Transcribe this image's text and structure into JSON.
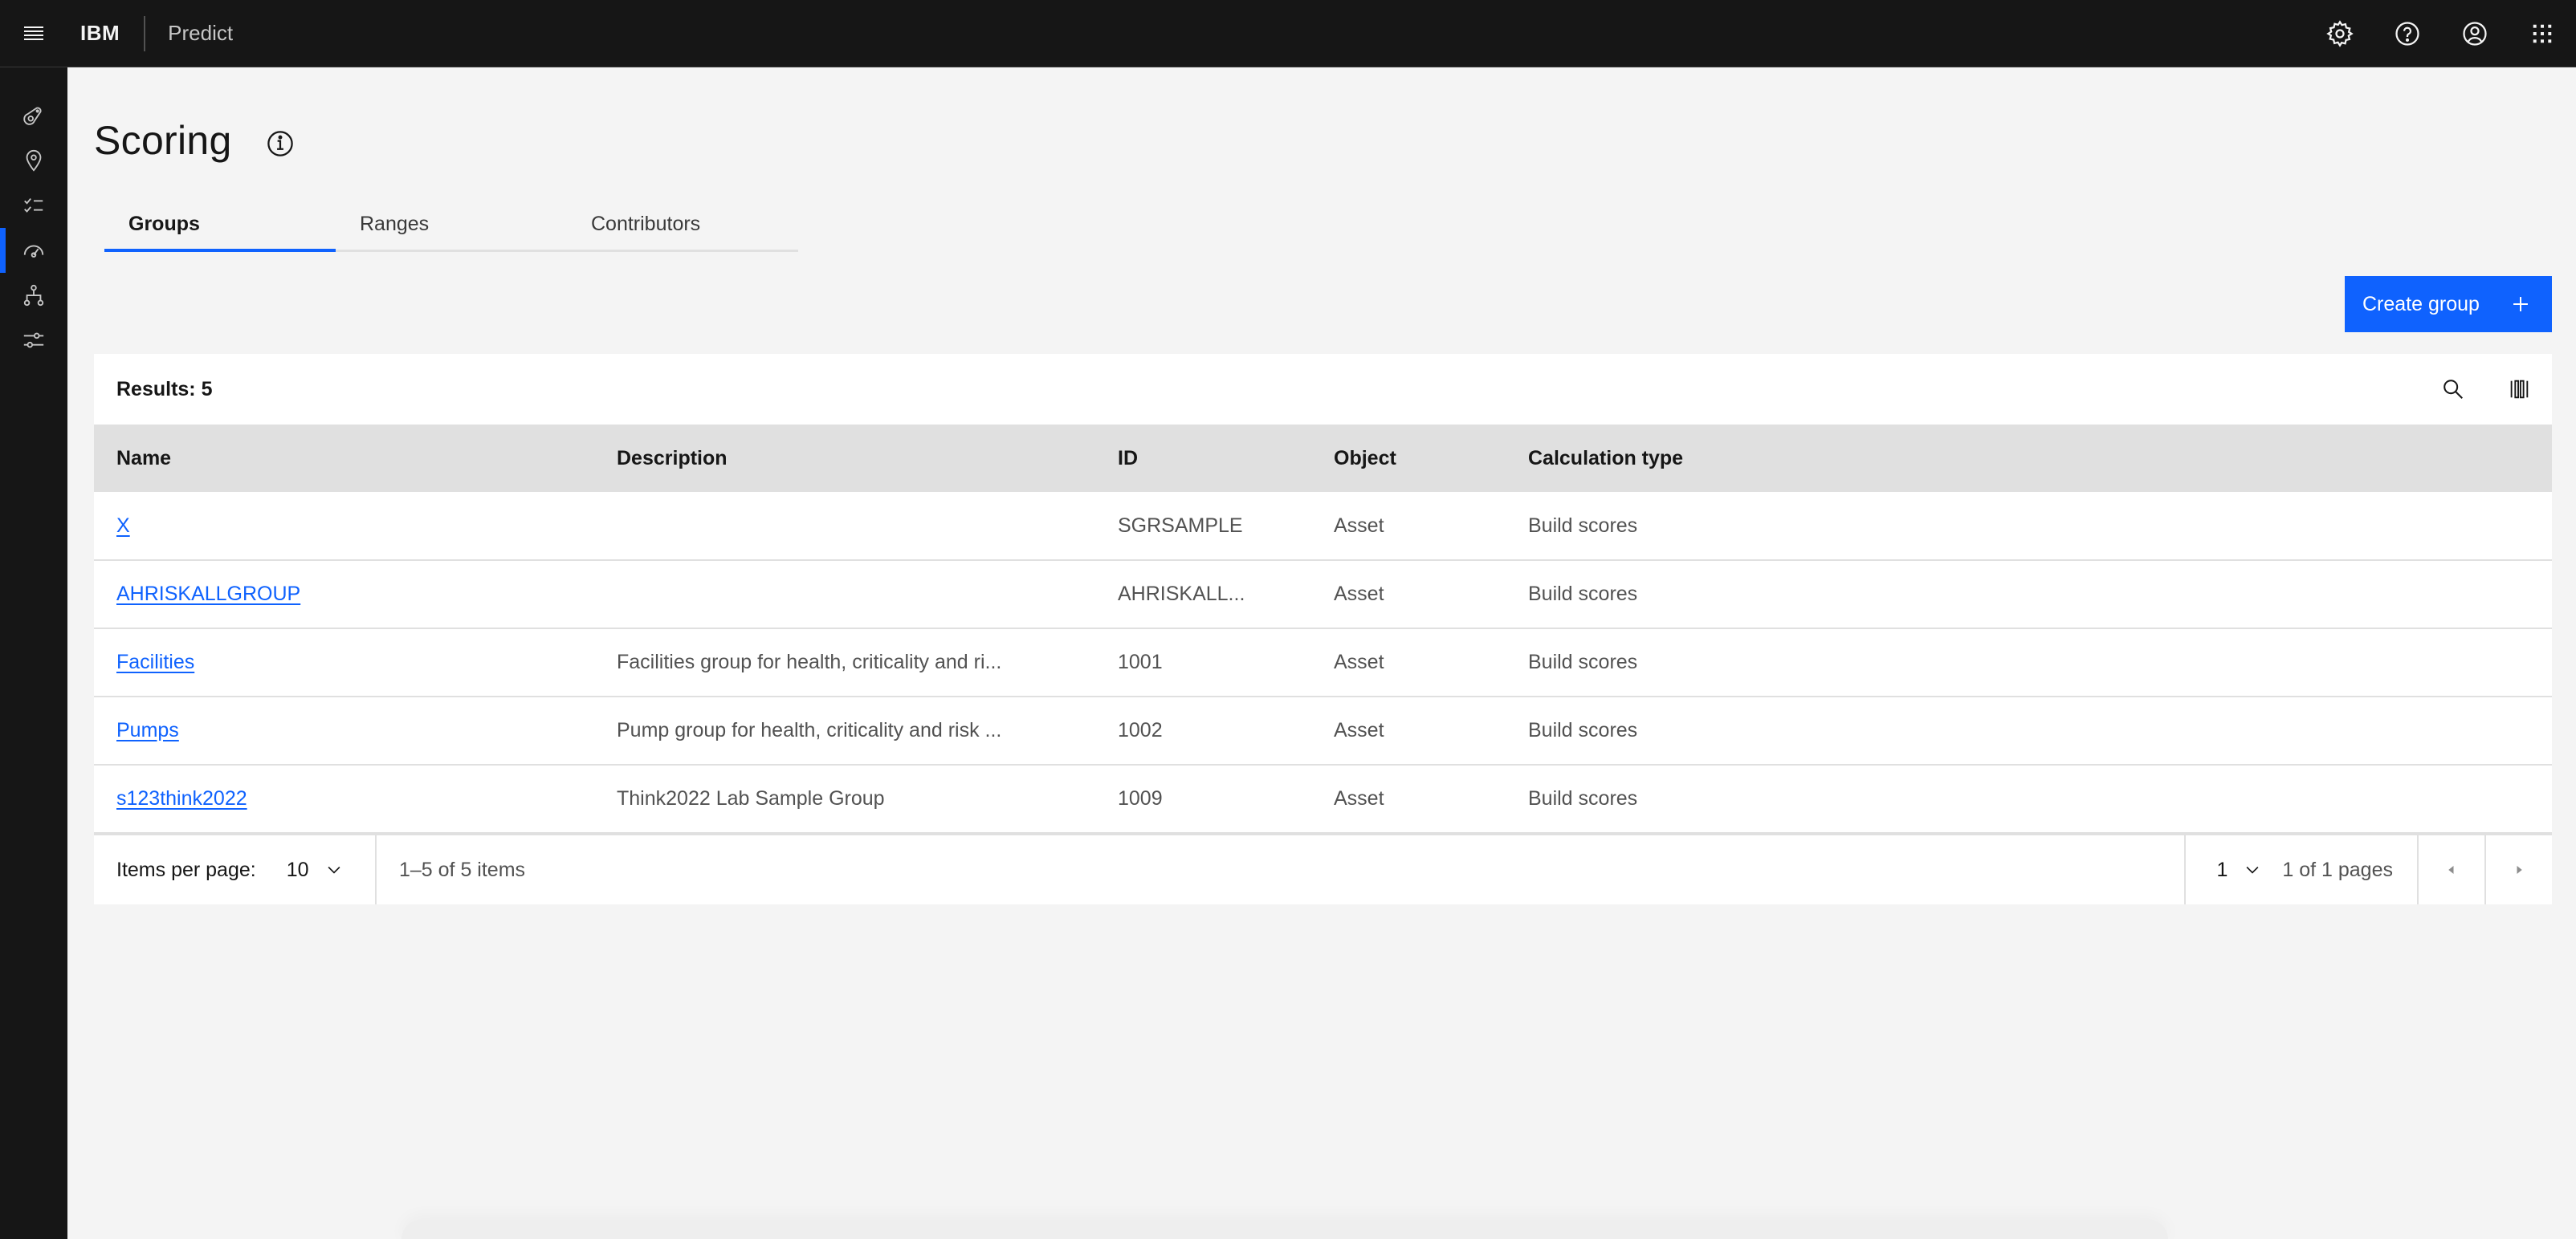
{
  "header": {
    "brand": "IBM",
    "product": "Predict",
    "icons": [
      "menu-icon",
      "settings-icon",
      "help-icon",
      "user-avatar-icon",
      "app-switcher-icon"
    ]
  },
  "rail": {
    "items": [
      {
        "name": "asset-tag-icon",
        "active": false
      },
      {
        "name": "location-icon",
        "active": false
      },
      {
        "name": "checklist-icon",
        "active": false
      },
      {
        "name": "meter-icon",
        "active": true
      },
      {
        "name": "hierarchy-icon",
        "active": false
      },
      {
        "name": "settings-adjust-icon",
        "active": false
      }
    ]
  },
  "page": {
    "title": "Scoring",
    "info_icon": "information-icon"
  },
  "tabs": [
    {
      "label": "Groups",
      "active": true
    },
    {
      "label": "Ranges",
      "active": false
    },
    {
      "label": "Contributors",
      "active": false
    }
  ],
  "actions": {
    "create_group_label": "Create group",
    "create_group_icon": "add-icon"
  },
  "table": {
    "results_label": "Results: 5",
    "toolbar_icons": [
      "search-icon",
      "column-icon"
    ],
    "columns": [
      "Name",
      "Description",
      "ID",
      "Object",
      "Calculation type"
    ],
    "rows": [
      {
        "name": "X",
        "description": "",
        "id": "SGRSAMPLE",
        "object": "Asset",
        "calc_type": "Build scores"
      },
      {
        "name": "AHRISKALLGROUP",
        "description": "",
        "id": "AHRISKALL...",
        "object": "Asset",
        "calc_type": "Build scores"
      },
      {
        "name": "Facilities",
        "description": "Facilities group for health, criticality and ri...",
        "id": "1001",
        "object": "Asset",
        "calc_type": "Build scores"
      },
      {
        "name": "Pumps",
        "description": "Pump group for health, criticality and risk ...",
        "id": "1002",
        "object": "Asset",
        "calc_type": "Build scores"
      },
      {
        "name": "s123think2022",
        "description": "Think2022 Lab Sample Group",
        "id": "1009",
        "object": "Asset",
        "calc_type": "Build scores"
      }
    ]
  },
  "pagination": {
    "items_per_page_label": "Items per page:",
    "items_per_page_value": "10",
    "range_text": "1–5 of 5 items",
    "page_value": "1",
    "page_of_text": "1 of 1 pages"
  },
  "colors": {
    "header_bg": "#161616",
    "accent": "#0f62fe",
    "page_bg": "#f4f4f4",
    "table_header_bg": "#e0e0e0",
    "link": "#0f62fe"
  }
}
